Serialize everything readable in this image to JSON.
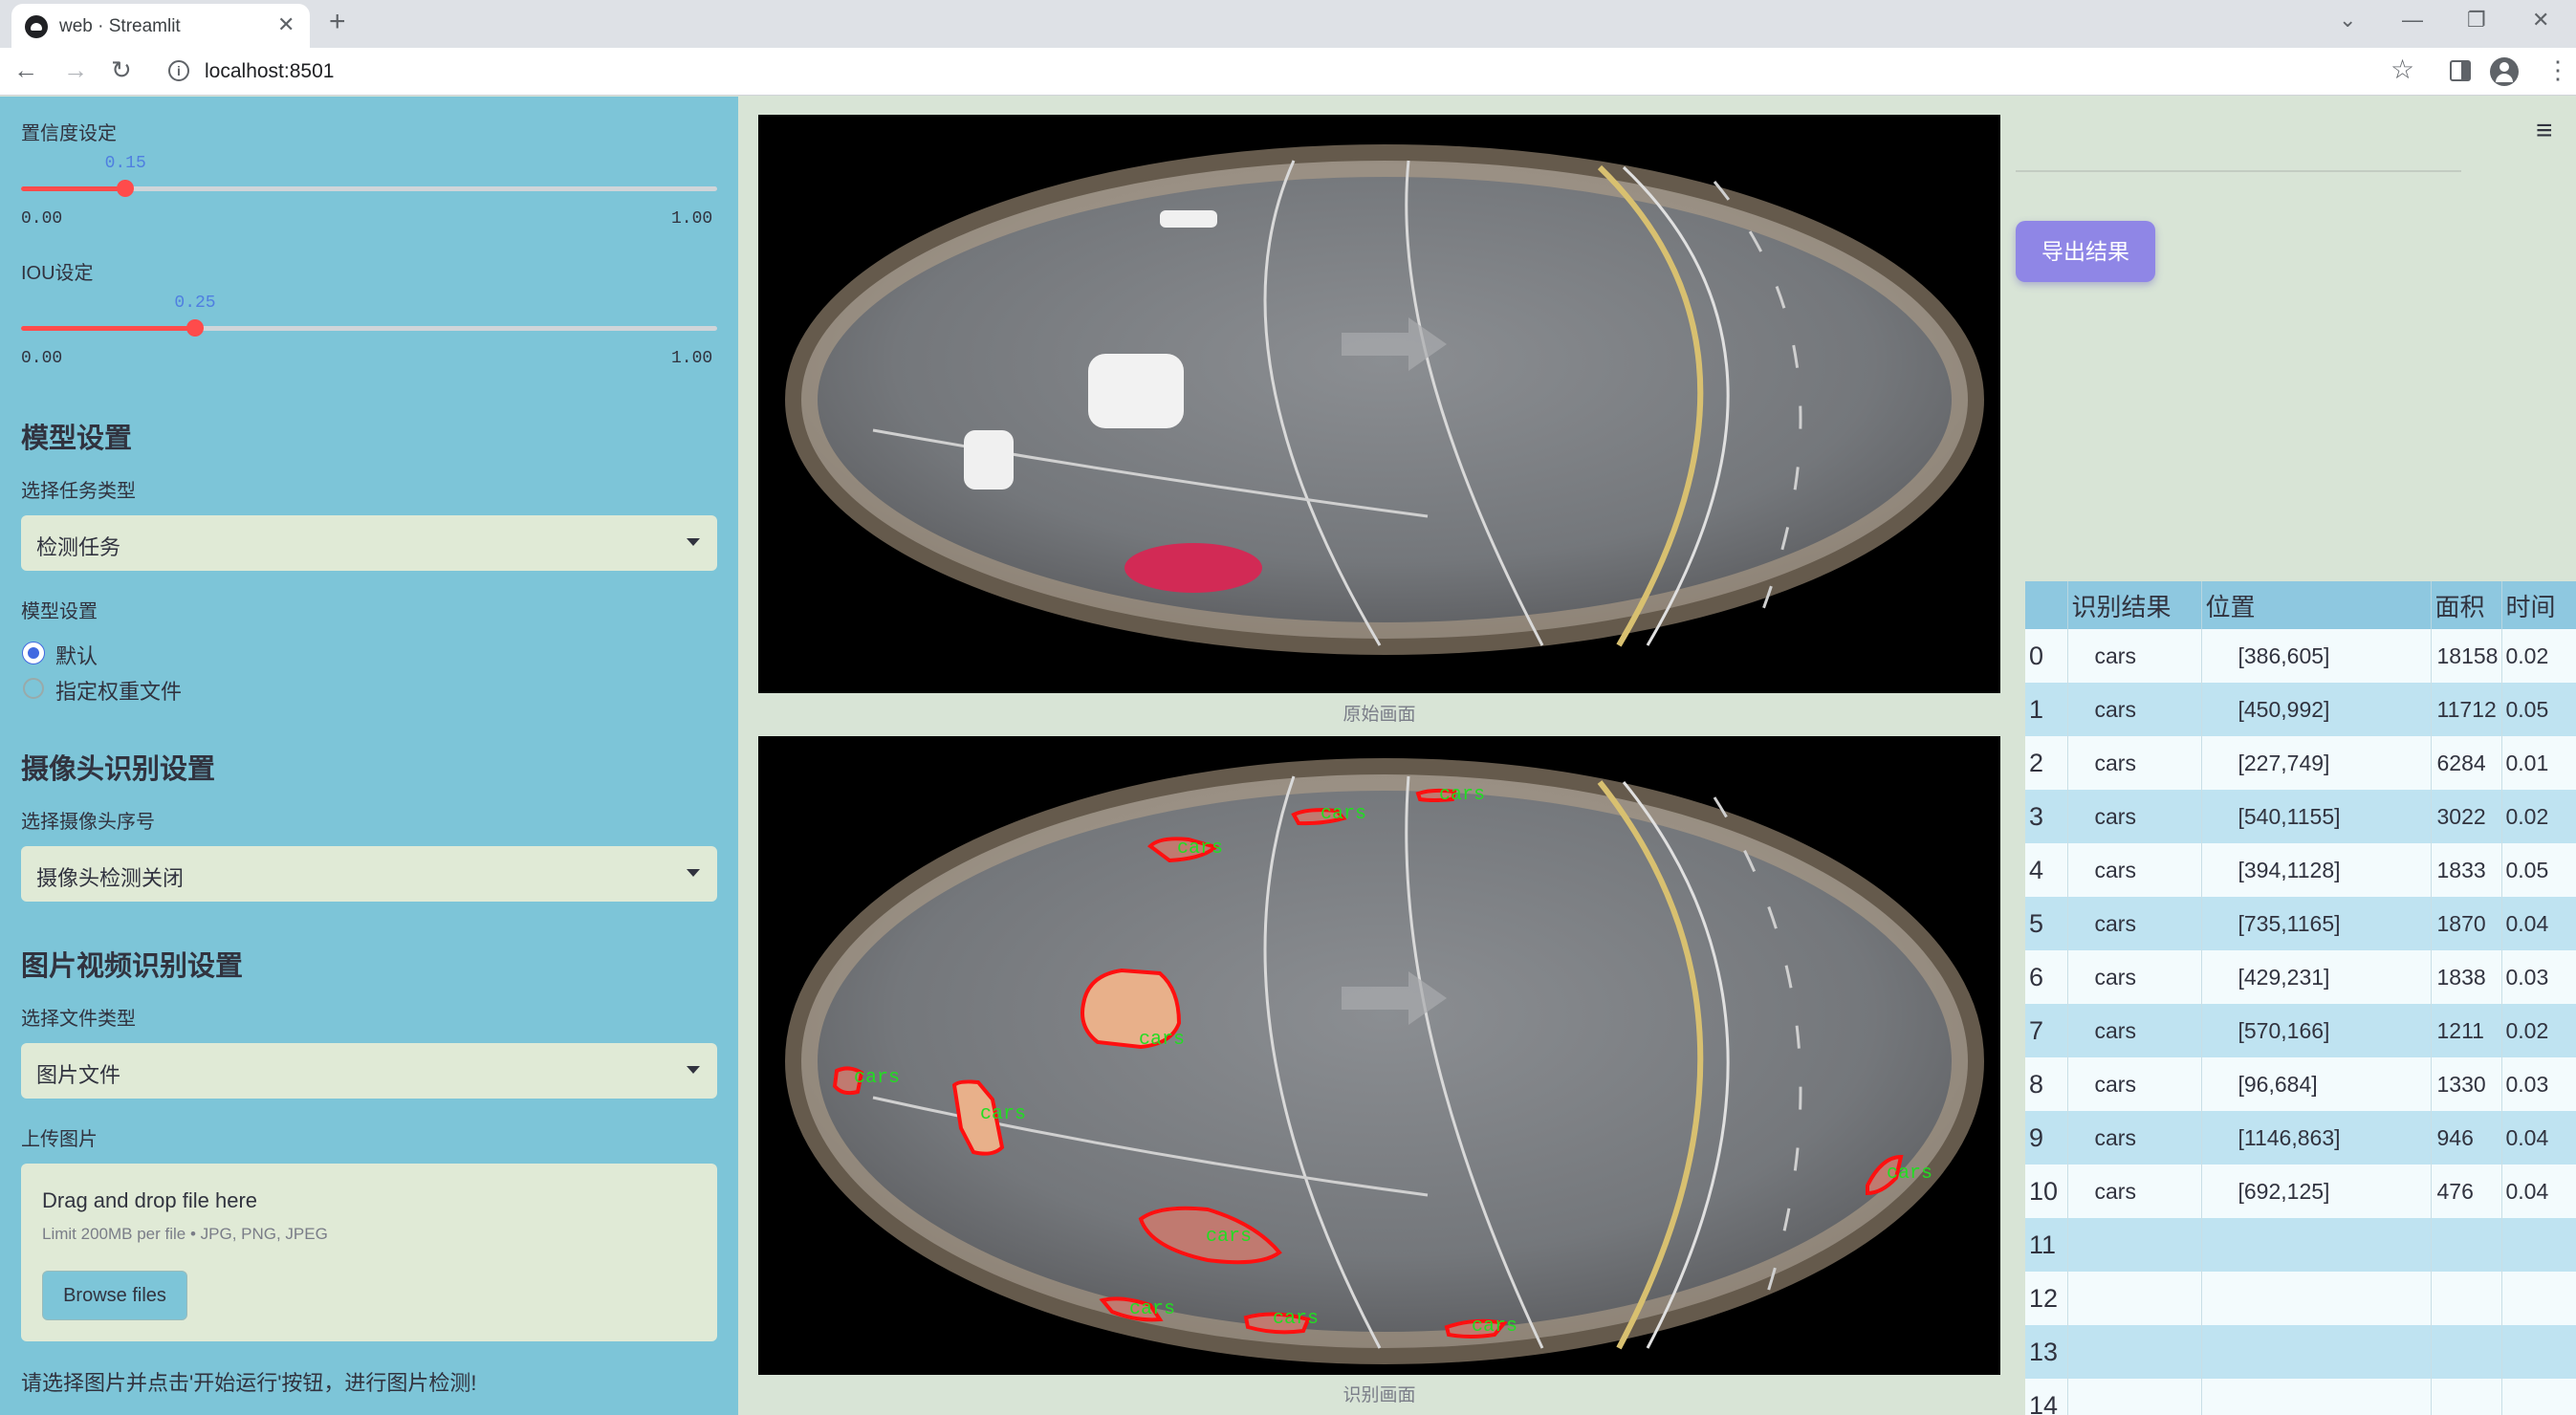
{
  "browser": {
    "tab_title": "web · Streamlit",
    "url": "localhost:8501",
    "icons": [
      "back-icon",
      "forward-icon",
      "reload-icon",
      "info-icon",
      "star-icon",
      "sidepanel-icon",
      "profile-icon",
      "menu-icon"
    ]
  },
  "sidebar": {
    "confidence": {
      "label": "置信度设定",
      "value": "0.15",
      "min": "0.00",
      "max": "1.00",
      "fraction": 0.15
    },
    "iou": {
      "label": "IOU设定",
      "value": "0.25",
      "min": "0.00",
      "max": "1.00",
      "fraction": 0.25
    },
    "model_section": {
      "heading": "模型设置",
      "task_label": "选择任务类型",
      "task_value": "检测任务",
      "model_label": "模型设置",
      "options": [
        "默认",
        "指定权重文件"
      ],
      "selected": "默认"
    },
    "camera_section": {
      "heading": "摄像头识别设置",
      "camera_label": "选择摄像头序号",
      "camera_value": "摄像头检测关闭"
    },
    "media_section": {
      "heading": "图片视频识别设置",
      "type_label": "选择文件类型",
      "type_value": "图片文件",
      "upload_label": "上传图片",
      "drop_title": "Drag and drop file here",
      "drop_limit": "Limit 200MB per file • JPG, PNG, JPEG",
      "browse_label": "Browse files"
    },
    "hint": "请选择图片并点击'开始运行'按钮，进行图片检测!"
  },
  "main": {
    "original_caption": "原始画面",
    "result_caption": "识别画面",
    "detection_label": "cars",
    "export_label": "导出结果"
  },
  "table": {
    "headers": [
      "",
      "识别结果",
      "位置",
      "面积",
      "时间"
    ],
    "rows": [
      [
        "0",
        "cars",
        "[386,605]",
        "18158",
        "0.02"
      ],
      [
        "1",
        "cars",
        "[450,992]",
        "11712",
        "0.05"
      ],
      [
        "2",
        "cars",
        "[227,749]",
        "6284",
        "0.01"
      ],
      [
        "3",
        "cars",
        "[540,1155]",
        "3022",
        "0.02"
      ],
      [
        "4",
        "cars",
        "[394,1128]",
        "1833",
        "0.05"
      ],
      [
        "5",
        "cars",
        "[735,1165]",
        "1870",
        "0.04"
      ],
      [
        "6",
        "cars",
        "[429,231]",
        "1838",
        "0.03"
      ],
      [
        "7",
        "cars",
        "[570,166]",
        "1211",
        "0.02"
      ],
      [
        "8",
        "cars",
        "[96,684]",
        "1330",
        "0.03"
      ],
      [
        "9",
        "cars",
        "[1146,863]",
        "946",
        "0.04"
      ],
      [
        "10",
        "cars",
        "[692,125]",
        "476",
        "0.04"
      ],
      [
        "11",
        "",
        "",
        "",
        ""
      ],
      [
        "12",
        "",
        "",
        "",
        ""
      ],
      [
        "13",
        "",
        "",
        "",
        ""
      ],
      [
        "14",
        "",
        "",
        "",
        ""
      ]
    ]
  }
}
